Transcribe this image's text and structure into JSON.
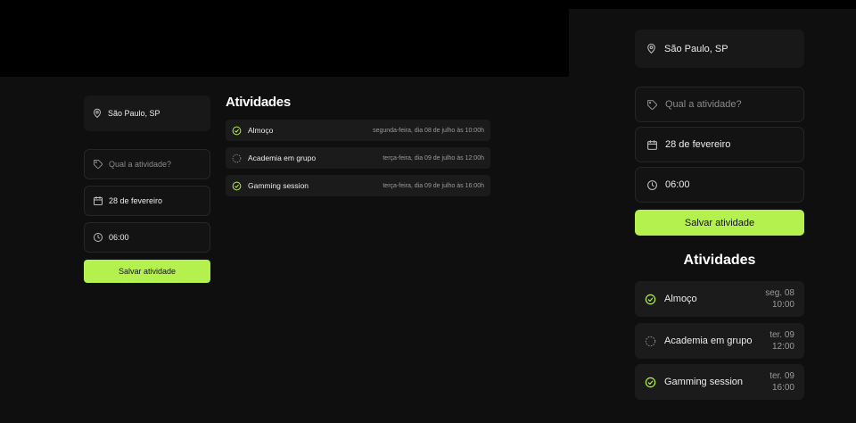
{
  "colors": {
    "accent": "#b4f14f",
    "background": "#0f0f0f",
    "card": "#181818",
    "done": "#b4f14f",
    "pending": "#8a8a8a"
  },
  "form": {
    "location": "São Paulo, SP",
    "activity_placeholder": "Qual a atividade?",
    "date": "28 de fevereiro",
    "time": "06:00",
    "save_label": "Salvar atividade"
  },
  "activities": {
    "title": "Atividades",
    "items": [
      {
        "name": "Almoço",
        "status": "done",
        "date_long": "segunda-feira, dia 08 de julho às 10:00h",
        "day_short": "seg. 08",
        "time_short": "10:00"
      },
      {
        "name": "Academia em grupo",
        "status": "pending",
        "date_long": "terça-feira, dia 09 de julho às 12:00h",
        "day_short": "ter. 09",
        "time_short": "12:00"
      },
      {
        "name": "Gamming session",
        "status": "done",
        "date_long": "terça-feira, dia 09 de julho às 16:00h",
        "day_short": "ter. 09",
        "time_short": "16:00"
      }
    ]
  }
}
